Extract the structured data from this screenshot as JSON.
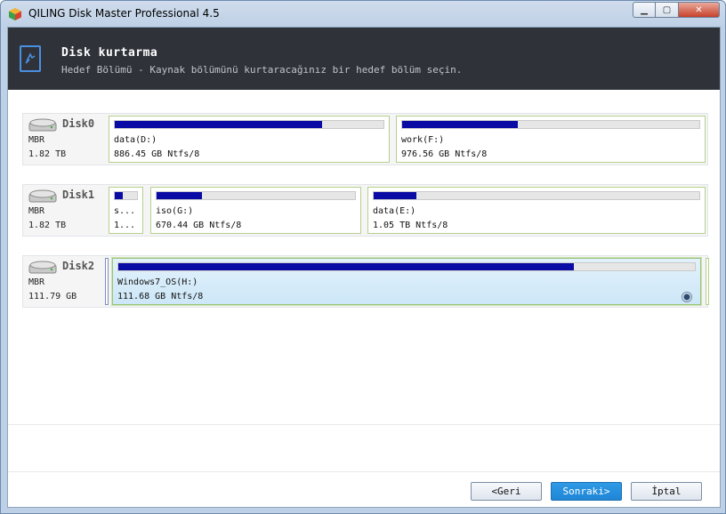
{
  "window": {
    "title": "QILING Disk Master Professional 4.5"
  },
  "header": {
    "title": "Disk kurtarma",
    "subtitle": "Hedef Bölümü - Kaynak bölümünü kurtaracağınız bir hedef bölüm seçin."
  },
  "disks": [
    {
      "name": "Disk0",
      "type": "MBR",
      "size": "1.82 TB",
      "partitions": [
        {
          "label": "data(D:)",
          "size": "886.45 GB Ntfs/8",
          "used_fraction": 0.77
        },
        {
          "label": "work(F:)",
          "size": "976.56 GB Ntfs/8",
          "used_fraction": 0.39
        }
      ]
    },
    {
      "name": "Disk1",
      "type": "MBR",
      "size": "1.82 TB",
      "partitions": [
        {
          "label": "s...",
          "size": "1...",
          "used_fraction": 0.35
        },
        {
          "label": "iso(G:)",
          "size": "670.44 GB Ntfs/8",
          "used_fraction": 0.23
        },
        {
          "label": "data(E:)",
          "size": "1.05 TB Ntfs/8",
          "used_fraction": 0.13
        }
      ]
    },
    {
      "name": "Disk2",
      "type": "MBR",
      "size": "111.79 GB",
      "partitions": [
        {
          "label": "Windows7_OS(H:)",
          "size": "111.68 GB Ntfs/8",
          "used_fraction": 0.79,
          "selected": true
        }
      ]
    }
  ],
  "buttons": {
    "back": "<Geri",
    "next": "Sonraki>",
    "cancel": "İptal"
  },
  "colors": {
    "header_bg": "#2f3339",
    "bar_fill": "#0a0aa5",
    "primary_button": "#1f86d6",
    "partition_border": "#b6d08c"
  },
  "icons": {
    "app": "app-cube-icon",
    "header": "disk-recovery-icon",
    "disk": "hard-disk-icon",
    "radio": "radio-selected-icon"
  }
}
